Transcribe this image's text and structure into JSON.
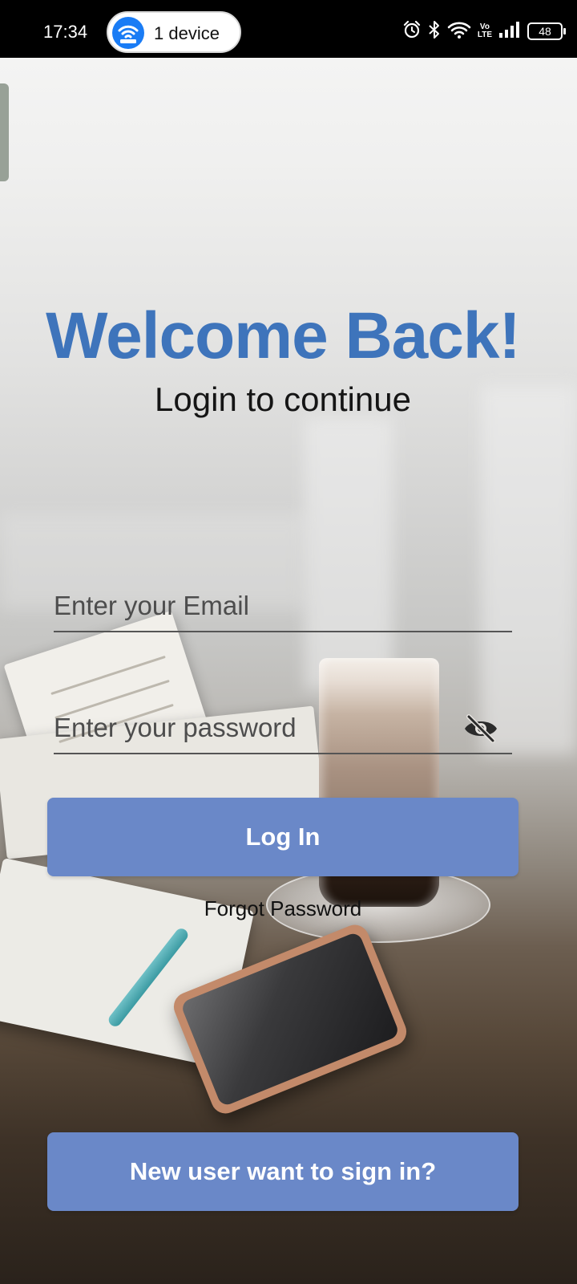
{
  "status_bar": {
    "time": "17:34",
    "hotspot_label": "1 device",
    "battery_level": "48",
    "icons": [
      "wifi-hotspot-icon",
      "alarm-icon",
      "bluetooth-icon",
      "wifi-icon",
      "volte-icon",
      "signal-icon",
      "battery-icon"
    ],
    "volte_text": "Vo LTE"
  },
  "login": {
    "title": "Welcome Back!",
    "subtitle": "Login to continue",
    "email_placeholder": "Enter your Email",
    "email_value": "",
    "password_placeholder": "Enter your password",
    "password_value": "",
    "login_button": "Log In",
    "forgot_password": "Forgot Password",
    "signup_button": "New user want to sign in?"
  },
  "colors": {
    "title": "#3e74bb",
    "button": "#6a88c8",
    "status_bar": "#000000",
    "hotspot_badge": "#1a7cf5"
  }
}
